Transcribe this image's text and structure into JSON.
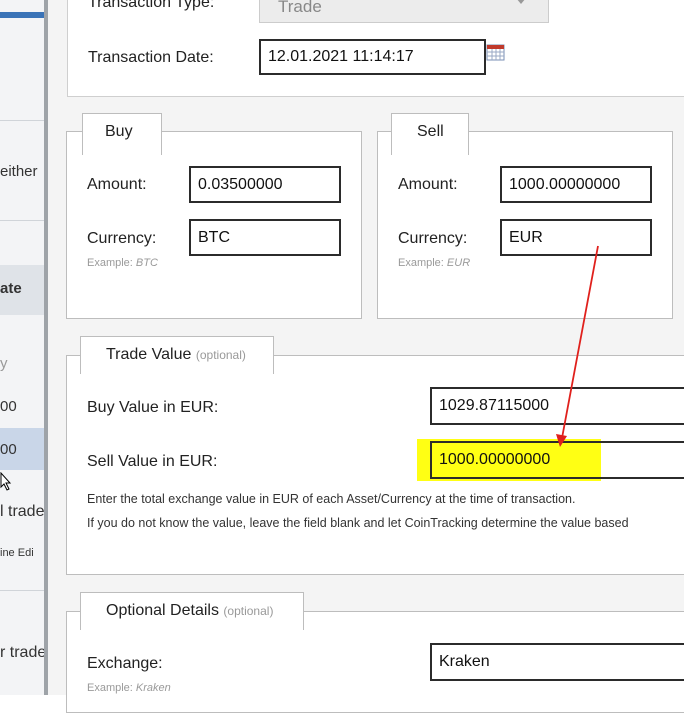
{
  "background_page": {
    "fragments": [
      "either",
      "ate",
      "y",
      "00",
      "00",
      "l trade",
      "ine Edi",
      "r trade"
    ]
  },
  "transaction": {
    "type_label": "Transaction Type:",
    "type_value": "Trade",
    "date_label": "Transaction Date:",
    "date_value": "12.01.2021 11:14:17"
  },
  "buy": {
    "legend": "Buy",
    "amount_label": "Amount:",
    "amount_value": "0.03500000",
    "currency_label": "Currency:",
    "currency_value": "BTC",
    "example_prefix": "Example:",
    "example_value": "BTC"
  },
  "sell": {
    "legend": "Sell",
    "amount_label": "Amount:",
    "amount_value": "1000.00000000",
    "currency_label": "Currency:",
    "currency_value": "EUR",
    "example_prefix": "Example:",
    "example_value": "EUR"
  },
  "trade_value": {
    "legend": "Trade Value",
    "legend_optional": "(optional)",
    "buy_value_label": "Buy Value in EUR:",
    "buy_value": "1029.87115000",
    "sell_value_label": "Sell Value in EUR:",
    "sell_value": "1000.00000000",
    "description_1": "Enter the total exchange value in EUR of each Asset/Currency at the time of transaction.",
    "description_2": "If you do not know the value, leave the field blank and let CoinTracking determine the value based"
  },
  "optional_details": {
    "legend": "Optional Details",
    "legend_optional": "(optional)",
    "exchange_label": "Exchange:",
    "exchange_value": "Kraken",
    "example_prefix": "Example:",
    "example_value": "Kraken"
  },
  "colors": {
    "highlight": "#ffff14",
    "annotation_arrow": "#e0201c",
    "input_border": "#2b2b2b",
    "modal_background": "#f4f4f4"
  },
  "icons": {
    "date_picker": "calendar-icon",
    "select": "chevron-down-icon",
    "annotation": "red-arrow"
  }
}
